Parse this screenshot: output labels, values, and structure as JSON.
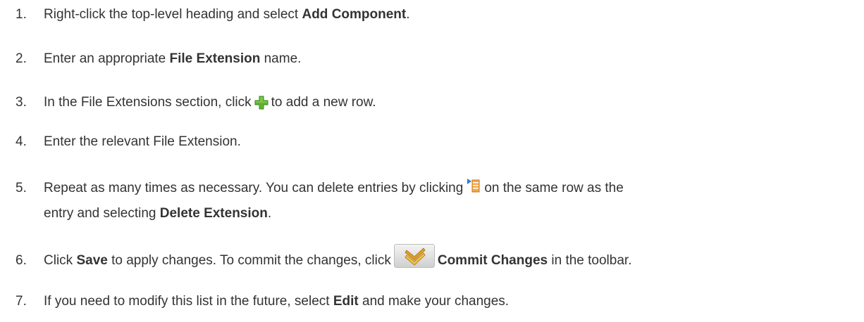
{
  "steps": [
    {
      "number": "1.",
      "text_a": "Right-click the top-level heading and select ",
      "bold_a": "Add Component",
      "text_b": "."
    },
    {
      "number": "2.",
      "text_a": "Enter an appropriate ",
      "bold_a": "File Extension",
      "text_b": " name."
    },
    {
      "number": "3.",
      "text_a": "In the File Extensions section, click",
      "icon": "plus-icon",
      "text_b": "to add a new row."
    },
    {
      "number": "4.",
      "text_a": "Enter the relevant File Extension."
    },
    {
      "number": "5.",
      "line1_text_a": "Repeat as many times as necessary. You can delete entries by clicking",
      "icon": "row-menu-icon",
      "line1_text_b": "on the same row as the",
      "line2_text_a": "entry and selecting ",
      "line2_bold": "Delete Extension",
      "line2_text_b": "."
    },
    {
      "number": "6.",
      "text_a": "Click ",
      "bold_a": "Save",
      "text_b": " to apply changes. To commit the changes, click",
      "icon": "commit-changes-icon",
      "bold_b": "Commit Changes",
      "text_c": " in the toolbar."
    },
    {
      "number": "7.",
      "text_a": "If you need to modify this list in the future, select ",
      "bold_a": "Edit",
      "text_b": " and make your changes."
    }
  ],
  "colors": {
    "text": "#333333",
    "plus_green": "#5fb42f",
    "menu_orange": "#f08c1e",
    "commit_gold": "#e0a020"
  }
}
